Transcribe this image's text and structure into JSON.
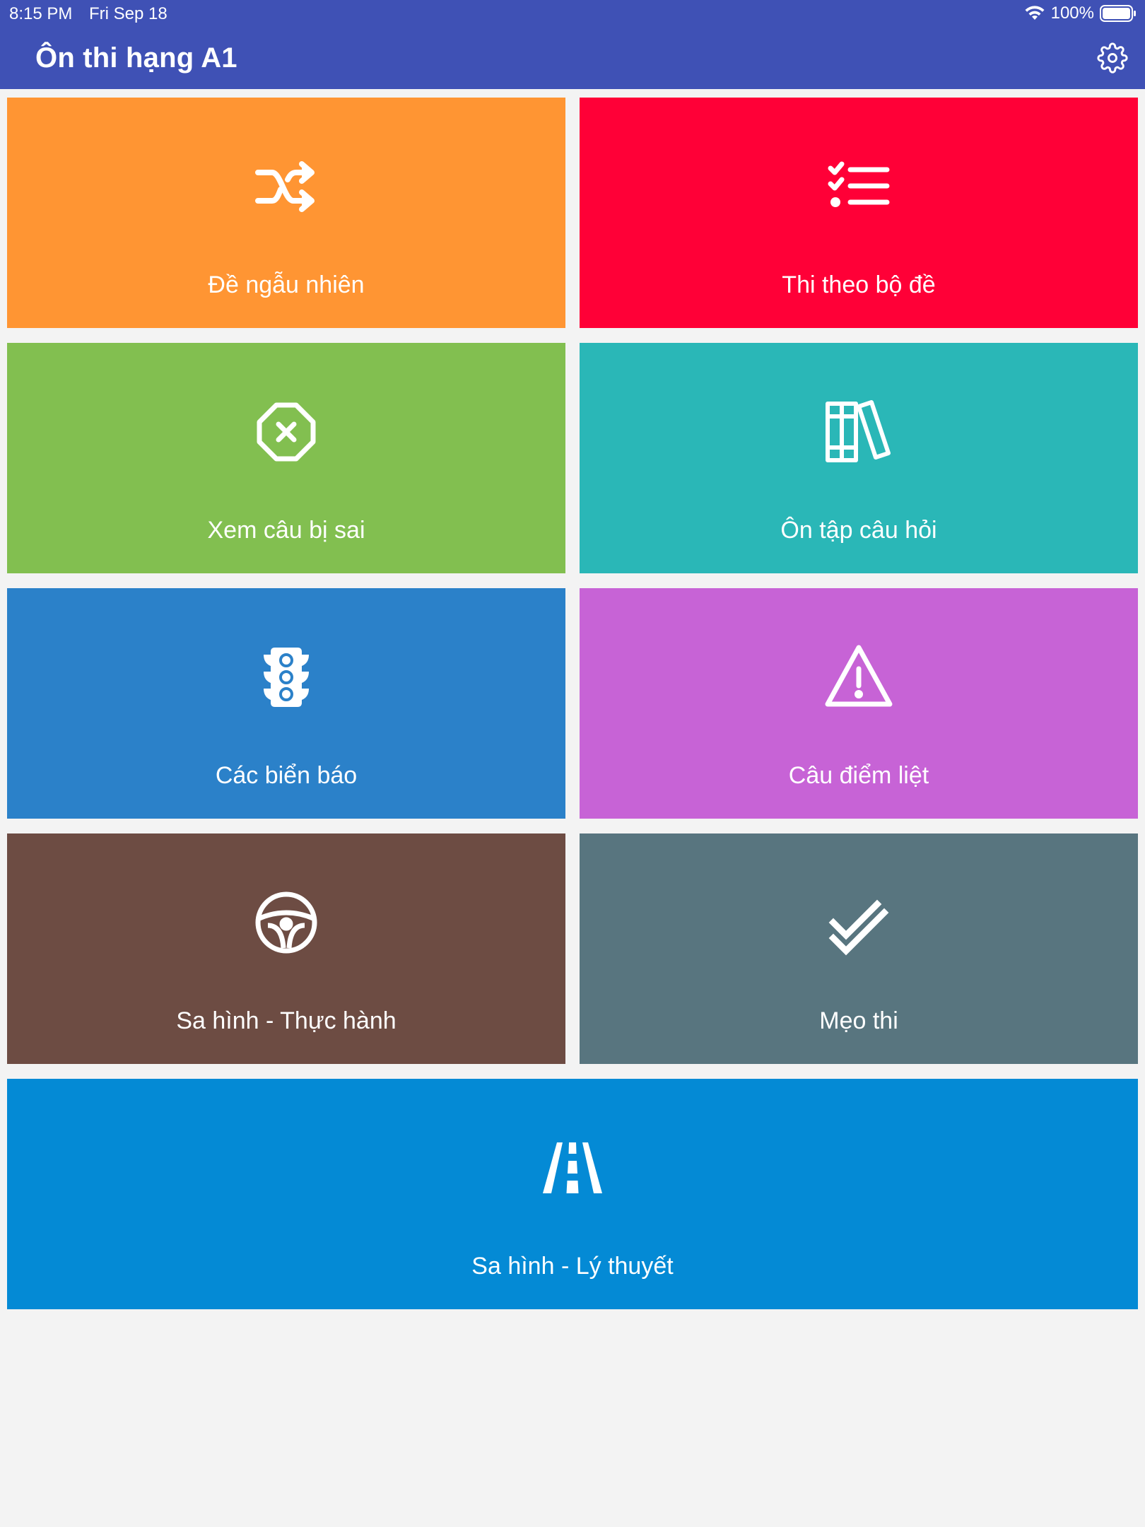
{
  "status_bar": {
    "time": "8:15 PM",
    "date": "Fri Sep 18",
    "battery": "100%"
  },
  "header": {
    "title": "Ôn thi hạng A1",
    "settings_icon": "gear-icon"
  },
  "tiles": [
    {
      "label": "Đề ngẫu nhiên",
      "icon": "shuffle-icon",
      "color": "#ff9533"
    },
    {
      "label": "Thi theo bộ đề",
      "icon": "checklist-icon",
      "color": "#ff0037"
    },
    {
      "label": "Xem câu bị sai",
      "icon": "stop-x-icon",
      "color": "#82bf50"
    },
    {
      "label": "Ôn tập câu hỏi",
      "icon": "books-icon",
      "color": "#2ab7b7"
    },
    {
      "label": "Các biển báo",
      "icon": "traffic-light-icon",
      "color": "#2b81c9"
    },
    {
      "label": "Câu điểm liệt",
      "icon": "warning-icon",
      "color": "#c763d6"
    },
    {
      "label": "Sa hình - Thực hành",
      "icon": "steering-wheel-icon",
      "color": "#6d4c43"
    },
    {
      "label": "Mẹo thi",
      "icon": "double-check-icon",
      "color": "#58757f"
    },
    {
      "label": "Sa hình - Lý thuyết",
      "icon": "road-icon",
      "color": "#048ad5"
    }
  ],
  "colors": {
    "header": "#3f51b5",
    "background": "#f3f3f3"
  }
}
